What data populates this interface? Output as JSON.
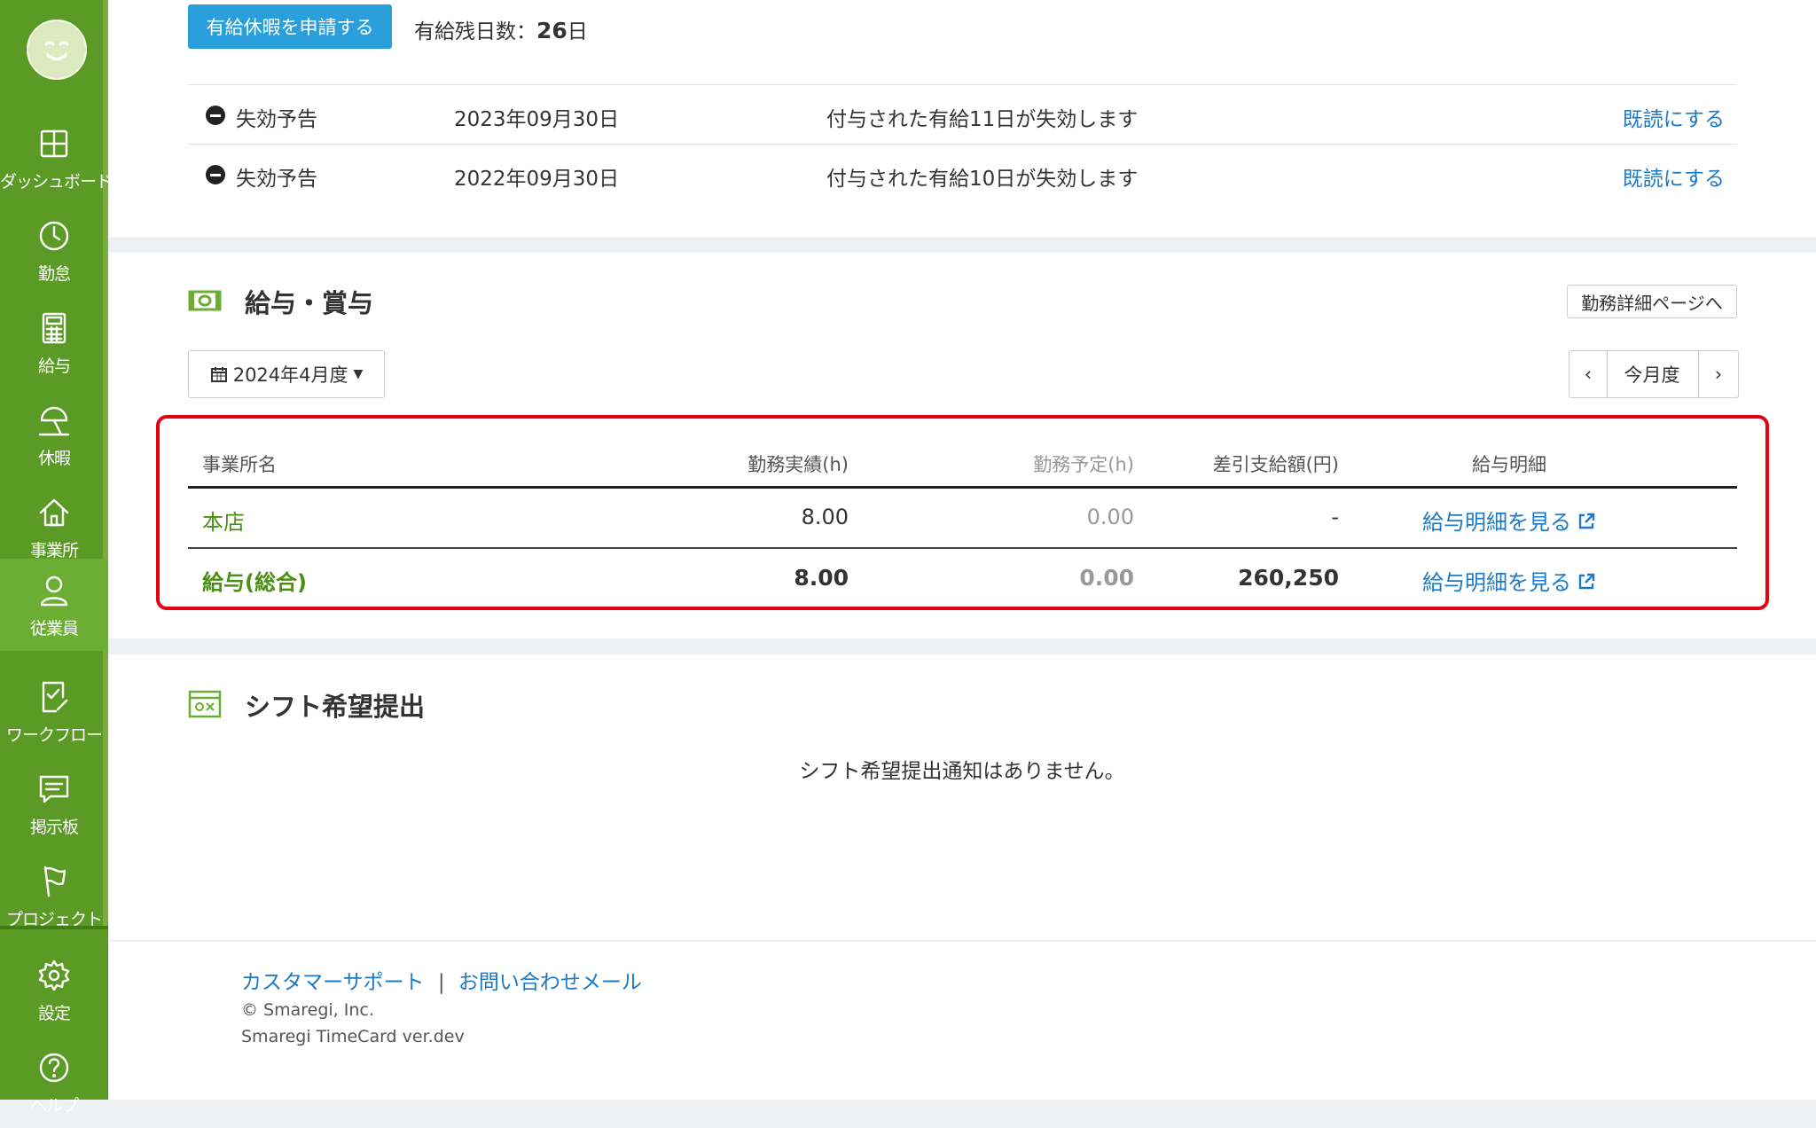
{
  "sidebar": {
    "items": [
      {
        "label": "ダッシュボード",
        "icon": "dashboard-icon"
      },
      {
        "label": "勤怠",
        "icon": "clock-icon"
      },
      {
        "label": "給与",
        "icon": "calculator-icon"
      },
      {
        "label": "休暇",
        "icon": "beach-umbrella-icon"
      },
      {
        "label": "事業所",
        "icon": "home-icon"
      },
      {
        "label": "従業員",
        "icon": "user-icon",
        "active": true
      },
      {
        "label": "ワークフロー",
        "icon": "checklist-icon"
      },
      {
        "label": "掲示板",
        "icon": "message-icon"
      },
      {
        "label": "プロジェクト",
        "icon": "flag-icon"
      },
      {
        "label": "設定",
        "icon": "gear-icon"
      },
      {
        "label": "ヘルプ",
        "icon": "help-icon"
      }
    ]
  },
  "leave": {
    "apply_button": "有給休暇を申請する",
    "remaining_label": "有給残日数：",
    "remaining_value": "26",
    "remaining_unit": "日",
    "notices": [
      {
        "type": "失効予告",
        "date": "2023年09月30日",
        "message": "付与された有給11日が失効します",
        "action": "既読にする"
      },
      {
        "type": "失効予告",
        "date": "2022年09月30日",
        "message": "付与された有給10日が失効します",
        "action": "既読にする"
      }
    ]
  },
  "salary": {
    "title": "給与・賞与",
    "detail_button": "勤務詳細ページへ",
    "month_selector": "2024年4月度",
    "pager": {
      "prev": "‹",
      "current": "今月度",
      "next": "›"
    },
    "columns": [
      "事業所名",
      "勤務実績(h)",
      "勤務予定(h)",
      "差引支給額(円)",
      "給与明細"
    ],
    "rows": [
      {
        "name": "本店",
        "actual": "8.00",
        "planned": "0.00",
        "net": "-",
        "link": "給与明細を見る"
      },
      {
        "name": "給与(総合)",
        "actual": "8.00",
        "planned": "0.00",
        "net": "260,250",
        "link": "給与明細を見る"
      }
    ]
  },
  "shift": {
    "title": "シフト希望提出",
    "empty_message": "シフト希望提出通知はありません。"
  },
  "footer": {
    "support": "カスタマーサポート",
    "divider": "|",
    "contact": "お問い合わせメール",
    "copyright": "© Smaregi, Inc.",
    "version": "Smaregi TimeCard ver.dev"
  },
  "colors": {
    "sidebar": "#5a9a25",
    "accent_blue": "#2a9fdb",
    "link": "#1d7ac6",
    "highlight_red": "#e60012",
    "green_text": "#4a8f13"
  }
}
